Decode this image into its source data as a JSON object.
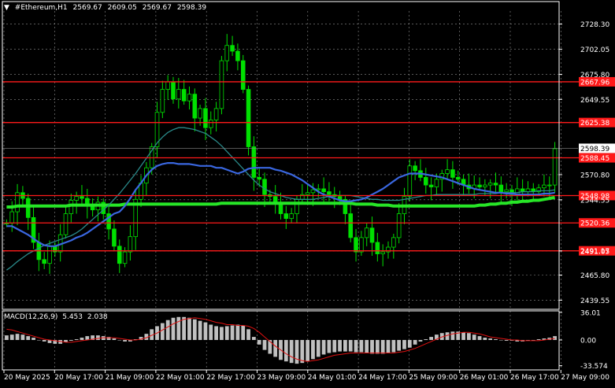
{
  "header": {
    "menu_symbol": "▼",
    "symbol": "#Ethereum,H1",
    "ohlc": [
      "2569.67",
      "2609.05",
      "2569.67",
      "2598.39"
    ]
  },
  "macd_header": {
    "name": "MACD(12,26,9)",
    "macd": "5.453",
    "signal": "2.038"
  },
  "colors": {
    "background": "#000000",
    "grid": "#8f8f8f",
    "candles": "#00e000",
    "ma_fast": "#3a67e0",
    "ma_mid": "#2a8a8a",
    "ma_slow": "#27e627",
    "levels": "#ff1a1a",
    "macd_hist": "#c0c0c0",
    "macd_signal": "#e01010",
    "current_price": "#ffffff"
  },
  "chart_data": [
    {
      "type": "line",
      "name": "price",
      "series": [
        {
          "name": "close",
          "values": [
            2520,
            2532,
            2552,
            2546,
            2526,
            2500,
            2482,
            2478,
            2496,
            2490,
            2508,
            2530,
            2544,
            2548,
            2546,
            2538,
            2534,
            2542,
            2530,
            2514,
            2496,
            2478,
            2490,
            2506,
            2545,
            2562,
            2578,
            2600,
            2636,
            2660,
            2668,
            2650,
            2660,
            2648,
            2655,
            2630,
            2640,
            2620,
            2628,
            2640,
            2690,
            2706,
            2700,
            2690,
            2660,
            2600,
            2568,
            2566,
            2550,
            2548,
            2542,
            2530,
            2525,
            2530,
            2545,
            2550,
            2552,
            2555,
            2556,
            2553,
            2550,
            2548,
            2545,
            2530,
            2505,
            2490,
            2505,
            2515,
            2500,
            2488,
            2490,
            2495,
            2505,
            2530,
            2548,
            2580,
            2575,
            2568,
            2560,
            2558,
            2566,
            2572,
            2576,
            2568,
            2566,
            2560,
            2556,
            2560,
            2558,
            2560,
            2562,
            2560,
            2553,
            2555,
            2550,
            2556,
            2553,
            2556,
            2553,
            2557,
            2560,
            2560,
            2598
          ]
        }
      ],
      "ylim": [
        2430,
        2742
      ],
      "x_tick_labels": [
        "20 May 2025",
        "20 May 17:00",
        "21 May 09:00",
        "22 May 01:00",
        "22 May 17:00",
        "23 May 09:00",
        "24 May 01:00",
        "24 May 17:00",
        "25 May 09:00",
        "26 May 01:00",
        "26 May 17:00",
        "27 May 09:00"
      ],
      "y_tick_labels": [
        "2728.30",
        "2702.05",
        "2675.80",
        "2649.55",
        "2570.80",
        "2544.55",
        "2491.05",
        "2465.80",
        "2439.55"
      ],
      "y_ticks": [
        2728.3,
        2702.05,
        2675.8,
        2649.55,
        2570.8,
        2544.55,
        2491.05,
        2465.8,
        2439.55
      ],
      "horizontal_levels": [
        {
          "label": "2667.96",
          "value": 2667.96
        },
        {
          "label": "2625.38",
          "value": 2625.38
        },
        {
          "label": "2588.45",
          "value": 2588.45
        },
        {
          "label": "2548.98",
          "value": 2548.98
        },
        {
          "label": "2520.36",
          "value": 2520.36
        },
        {
          "label": "2491.17",
          "value": 2491.17
        }
      ],
      "current_price": {
        "label": "2598.39",
        "value": 2598.39
      },
      "moving_averages": [
        {
          "color_key": "ma_fast",
          "values": [
            2517,
            2517,
            2514,
            2511,
            2508,
            2504,
            2500,
            2497,
            2496,
            2496,
            2498,
            2500,
            2502,
            2505,
            2507,
            2510,
            2514,
            2518,
            2522,
            2526,
            2530,
            2532,
            2538,
            2546,
            2555,
            2562,
            2570,
            2576,
            2580,
            2582,
            2583,
            2583,
            2582,
            2582,
            2582,
            2581,
            2580,
            2580,
            2580,
            2578,
            2578,
            2576,
            2574,
            2572,
            2574,
            2577,
            2578,
            2578,
            2578,
            2578,
            2576,
            2575,
            2573,
            2571,
            2568,
            2565,
            2561,
            2557,
            2553,
            2550,
            2548,
            2546,
            2544,
            2543,
            2543,
            2544,
            2545,
            2547,
            2550,
            2553,
            2556,
            2560,
            2564,
            2568,
            2570,
            2572,
            2572,
            2572,
            2571,
            2570,
            2569,
            2568,
            2566,
            2564,
            2562,
            2560,
            2558,
            2556,
            2555,
            2554,
            2553,
            2552,
            2552,
            2551,
            2551,
            2550,
            2550,
            2550,
            2550,
            2550,
            2551,
            2551,
            2552
          ]
        },
        {
          "color_key": "ma_mid",
          "values": [
            2471,
            2475,
            2480,
            2484,
            2488,
            2491,
            2494,
            2497,
            2499,
            2501,
            2503,
            2505,
            2507,
            2510,
            2514,
            2519,
            2524,
            2529,
            2534,
            2539,
            2545,
            2551,
            2558,
            2565,
            2572,
            2580,
            2588,
            2596,
            2604,
            2610,
            2615,
            2618,
            2620,
            2620,
            2619,
            2618,
            2616,
            2614,
            2610,
            2606,
            2601,
            2595,
            2589,
            2583,
            2577,
            2571,
            2565,
            2560,
            2556,
            2553,
            2551,
            2549,
            2547,
            2546,
            2545,
            2545,
            2545,
            2545,
            2546,
            2547,
            2548,
            2549,
            2549,
            2549,
            2549,
            2548,
            2547,
            2546,
            2545,
            2545,
            2544,
            2544,
            2544,
            2544,
            2545,
            2546,
            2547,
            2548,
            2549,
            2549,
            2550,
            2550,
            2550,
            2550,
            2550,
            2550,
            2550,
            2550,
            2551,
            2551,
            2551,
            2551,
            2552,
            2552,
            2552,
            2552,
            2553,
            2553,
            2553,
            2554,
            2554,
            2554,
            2555
          ]
        },
        {
          "color_key": "ma_slow",
          "values": [
            2537,
            2537,
            2538,
            2538,
            2538,
            2538,
            2538,
            2538,
            2538,
            2538,
            2538,
            2538,
            2539,
            2539,
            2539,
            2539,
            2539,
            2539,
            2539,
            2539,
            2539,
            2539,
            2540,
            2540,
            2540,
            2540,
            2540,
            2540,
            2540,
            2540,
            2540,
            2540,
            2540,
            2540,
            2540,
            2540,
            2540,
            2540,
            2540,
            2540,
            2541,
            2541,
            2541,
            2541,
            2541,
            2541,
            2541,
            2541,
            2541,
            2541,
            2541,
            2541,
            2541,
            2541,
            2541,
            2541,
            2541,
            2541,
            2541,
            2541,
            2541,
            2541,
            2541,
            2541,
            2541,
            2540,
            2540,
            2540,
            2540,
            2539,
            2539,
            2539,
            2538,
            2538,
            2538,
            2538,
            2538,
            2538,
            2538,
            2538,
            2538,
            2538,
            2538,
            2538,
            2538,
            2538,
            2538,
            2538,
            2539,
            2539,
            2540,
            2540,
            2541,
            2541,
            2542,
            2542,
            2543,
            2543,
            2544,
            2544,
            2545,
            2546,
            2547
          ]
        }
      ]
    },
    {
      "type": "bar",
      "name": "MACD(12,26,9)",
      "ylim": [
        -36,
        38
      ],
      "y_tick_labels": [
        "36.01",
        "0.00",
        "-33.574"
      ],
      "y_ticks": [
        36.01,
        0,
        -33.574
      ],
      "histogram": [
        6,
        7,
        8,
        7,
        5,
        3,
        0,
        -2,
        -4,
        -5,
        -5,
        -3,
        -1,
        1,
        3,
        5,
        6,
        6,
        5,
        4,
        2,
        0,
        -2,
        -2,
        1,
        4,
        8,
        14,
        18,
        22,
        26,
        29,
        30,
        30,
        29,
        27,
        25,
        23,
        20,
        18,
        17,
        18,
        19,
        20,
        19,
        14,
        4,
        -6,
        -13,
        -18,
        -22,
        -26,
        -28,
        -30,
        -31,
        -30,
        -28,
        -25,
        -22,
        -19,
        -17,
        -16,
        -15,
        -15,
        -15,
        -16,
        -16,
        -17,
        -18,
        -18,
        -18,
        -17,
        -16,
        -14,
        -12,
        -10,
        -6,
        -2,
        1,
        4,
        7,
        9,
        10,
        11,
        11,
        10,
        9,
        7,
        5,
        3,
        2,
        1,
        0,
        -1,
        -1,
        -2,
        -2,
        -1,
        0,
        1,
        2,
        3,
        5
      ],
      "signal": [
        14,
        13,
        11,
        9,
        7,
        5,
        3,
        1,
        0,
        -1,
        -2,
        -3,
        -3,
        -2,
        -1,
        0,
        1,
        2,
        3,
        3,
        3,
        2,
        1,
        0,
        0,
        1,
        3,
        6,
        9,
        13,
        17,
        21,
        24,
        27,
        28,
        29,
        28,
        27,
        25,
        23,
        22,
        20,
        20,
        19,
        19,
        18,
        15,
        10,
        4,
        -2,
        -8,
        -13,
        -18,
        -22,
        -25,
        -27,
        -28,
        -27,
        -26,
        -24,
        -22,
        -20,
        -19,
        -18,
        -17,
        -17,
        -17,
        -17,
        -17,
        -17,
        -17,
        -17,
        -17,
        -16,
        -15,
        -13,
        -11,
        -8,
        -5,
        -2,
        1,
        4,
        6,
        8,
        9,
        10,
        10,
        9,
        8,
        6,
        4,
        3,
        2,
        1,
        0,
        0,
        -1,
        -1,
        -1,
        -1,
        0,
        1,
        2
      ]
    }
  ]
}
